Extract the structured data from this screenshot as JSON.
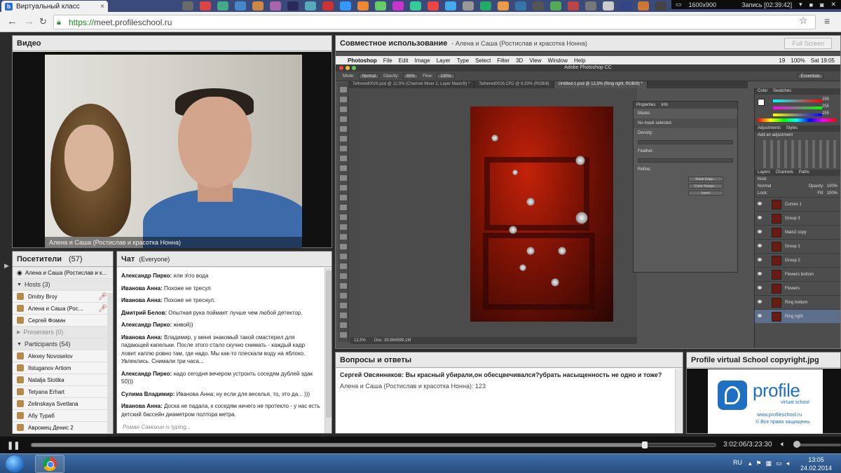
{
  "browser": {
    "tab_title": "Виртуальный класс",
    "tab_close": "×",
    "url_scheme": "https://",
    "url_host": "meet.profileschool.ru",
    "favicon_letter": "b",
    "recorder": {
      "resolution": "1600x900",
      "record_label": "Запись [02:39:42]"
    }
  },
  "video": {
    "header": "Видео",
    "caption": "Алена и Саша (Ростислав и красотка Нонна)"
  },
  "attendees": {
    "header": "Посетители",
    "count": "(57)",
    "current_user": "Алена и Саша (Ростислав и к...",
    "groups": {
      "hosts": "Hosts (3)",
      "presenters": "Presenters (0)",
      "participants": "Participants (54)"
    },
    "hosts": [
      "Dmitry Broy",
      "Алена и Саша (Рос...",
      "Сергей Фомин"
    ],
    "participants": [
      "Alexey Novoselov",
      "Ilstuganov Artiom",
      "Natalja Stotika",
      "Tetyana Erhart",
      "Zelinskaya Svetlana",
      "Абу Тураб",
      "Авромец Денис 2"
    ]
  },
  "chat": {
    "header": "Чат",
    "scope": "(Everyone)",
    "messages": [
      {
        "author": "Александр Пирко:",
        "text": "или э\\то вода"
      },
      {
        "author": "Иванова Анна:",
        "text": "Похоже не тресул"
      },
      {
        "author": "Иванова Анна:",
        "text": "Похоже не треснул."
      },
      {
        "author": "Дмитрий Белов:",
        "text": "Опытная рука поймает лучше чем любой детектор."
      },
      {
        "author": "Александр Пирко:",
        "text": "живой))"
      },
      {
        "author": "Иванова Анна:",
        "text": "Владимир, у меня знакомый такой смастерил для падающей капельки. После этого стало скучно снимать - каждый кадр ловит каплю ровно там, где надо. Мы как-то плескали воду на яблоко. Увлеклись. Снимали три часа..."
      },
      {
        "author": "Александр Пирко:",
        "text": "надо сегодня вечером устроить соседям дублей эдак 50)))"
      },
      {
        "author": "Сулима Владимир:",
        "text": "Иванова Анна: ну если для веселья, то, это да... )))"
      },
      {
        "author": "Иванова Анна:",
        "text": "Доска не падала, к соседям ничего не протекло - у нас есть детский бассейн диаметром полтора метра."
      }
    ],
    "typing": "Роман Самохин is typing..."
  },
  "share": {
    "header": "Совместное использование",
    "sub": "- Алена и Саша (Ростислав и красотка Нонна)",
    "fullscreen_label": "Full Screen",
    "photoshop": {
      "menu": [
        "Photoshop",
        "File",
        "Edit",
        "Image",
        "Layer",
        "Type",
        "Select",
        "Filter",
        "3D",
        "View",
        "Window",
        "Help"
      ],
      "menu_right": [
        "19",
        "100%",
        "Sat 19:05"
      ],
      "app_title": "Adobe Photoshop CC",
      "options": {
        "mode_label": "Mode:",
        "mode": "Normal",
        "opacity_label": "Opacity:",
        "opacity": "66%",
        "flow_label": "Flow:",
        "flow": "100%",
        "workspace": "Essentials"
      },
      "doc_tabs": [
        "Tethered0026.psd @ 12,5% (Channel Mixer 2, Layer Mask/8) *",
        "Tethered0026.CR2 @ 8,33% (RGB/8)",
        "Untitled-1.psd @ 12,5% (Ring right, RGB/8) *"
      ],
      "status_zoom": "12,5%",
      "status_doc": "Doc: 39,8M/699,1M",
      "properties": {
        "tabs": [
          "Properties",
          "Info"
        ],
        "title": "Masks",
        "no_mask": "No mask selected",
        "density": "Density:",
        "feather": "Feather:",
        "refine": "Refine:",
        "mask_edge": "Mask Edge...",
        "color_range": "Color Range...",
        "invert": "Invert"
      },
      "right_panels": {
        "color_tabs": [
          "Color",
          "Swatches"
        ],
        "rgb": [
          "255",
          "255",
          "255"
        ],
        "adj_tabs": [
          "Adjustments",
          "Styles"
        ],
        "add_adj": "Add an adjustment",
        "layer_tabs": [
          "Layers",
          "Channels",
          "Paths"
        ],
        "blend": "Normal",
        "opacity_label": "Opacity:",
        "opacity": "100%",
        "fill_label": "Fill:",
        "fill": "100%",
        "lock": "Lock:",
        "kind": "Kind",
        "layers": [
          "Curves 1",
          "Group 3",
          "Main2 copy",
          "Group 1",
          "Group 2",
          "Flowers bottom",
          "Flowers",
          "Ring bottom",
          "Ring right"
        ]
      }
    }
  },
  "qa": {
    "header": "Вопросы и ответы",
    "question": "Сергей Овсянников: Вы красный убирали,он обесцвечивался?убрать насыщенность не одно и тоже?",
    "answer": "Алена и Саша (Ростислав и красотка Нонна): 123"
  },
  "copyright": {
    "header": "Profile virtual School copyright.jpg",
    "logo_word": "profile",
    "logo_sub": "virtual school",
    "url": "www.profileschool.ru",
    "rights": "© Все права защищены"
  },
  "player": {
    "time": "3:02:06/3:23:30",
    "progress": 0.897,
    "volume": 0.0
  },
  "taskbar": {
    "lang": "RU",
    "time": "13:05",
    "date": "24.02.2014"
  },
  "colors": {
    "accent": "#1f6fc2",
    "photoshop_bg": "#535353",
    "chrome_tab": "#f1f1f1"
  }
}
